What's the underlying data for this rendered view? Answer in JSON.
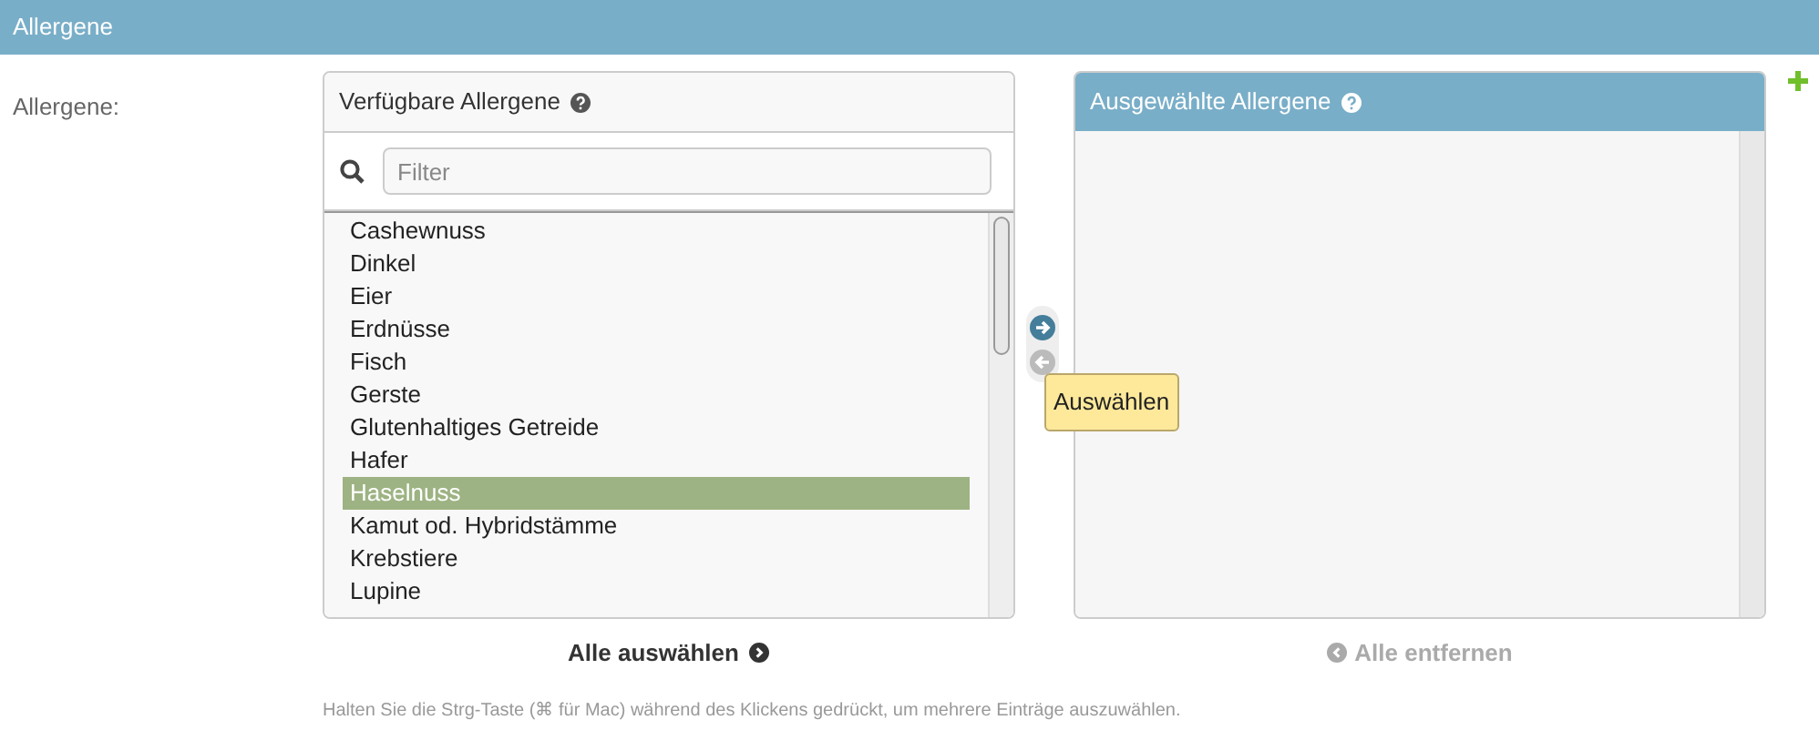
{
  "section_title": "Allergene",
  "field_label": "Allergene:",
  "available": {
    "title": "Verfügbare Allergene",
    "filter": {
      "placeholder": "Filter"
    },
    "items": [
      {
        "label": "Cashewnuss",
        "selected": false
      },
      {
        "label": "Dinkel",
        "selected": false
      },
      {
        "label": "Eier",
        "selected": false
      },
      {
        "label": "Erdnüsse",
        "selected": false
      },
      {
        "label": "Fisch",
        "selected": false
      },
      {
        "label": "Gerste",
        "selected": false
      },
      {
        "label": "Glutenhaltiges Getreide",
        "selected": false
      },
      {
        "label": "Hafer",
        "selected": false
      },
      {
        "label": "Haselnuss",
        "selected": true
      },
      {
        "label": "Kamut od. Hybridstämme",
        "selected": false
      },
      {
        "label": "Krebstiere",
        "selected": false
      },
      {
        "label": "Lupine",
        "selected": false
      }
    ],
    "action": {
      "label": "Alle auswählen",
      "disabled": false
    }
  },
  "transfer": {
    "add_disabled": false,
    "remove_disabled": true,
    "tooltip": "Auswählen"
  },
  "chosen": {
    "title": "Ausgewählte Allergene",
    "action": {
      "label": "Alle entfernen",
      "disabled": true
    }
  },
  "help_text": "Halten Sie die Strg-Taste (⌘ für Mac) während des Klickens gedrückt, um mehrere Einträge auszuwählen."
}
